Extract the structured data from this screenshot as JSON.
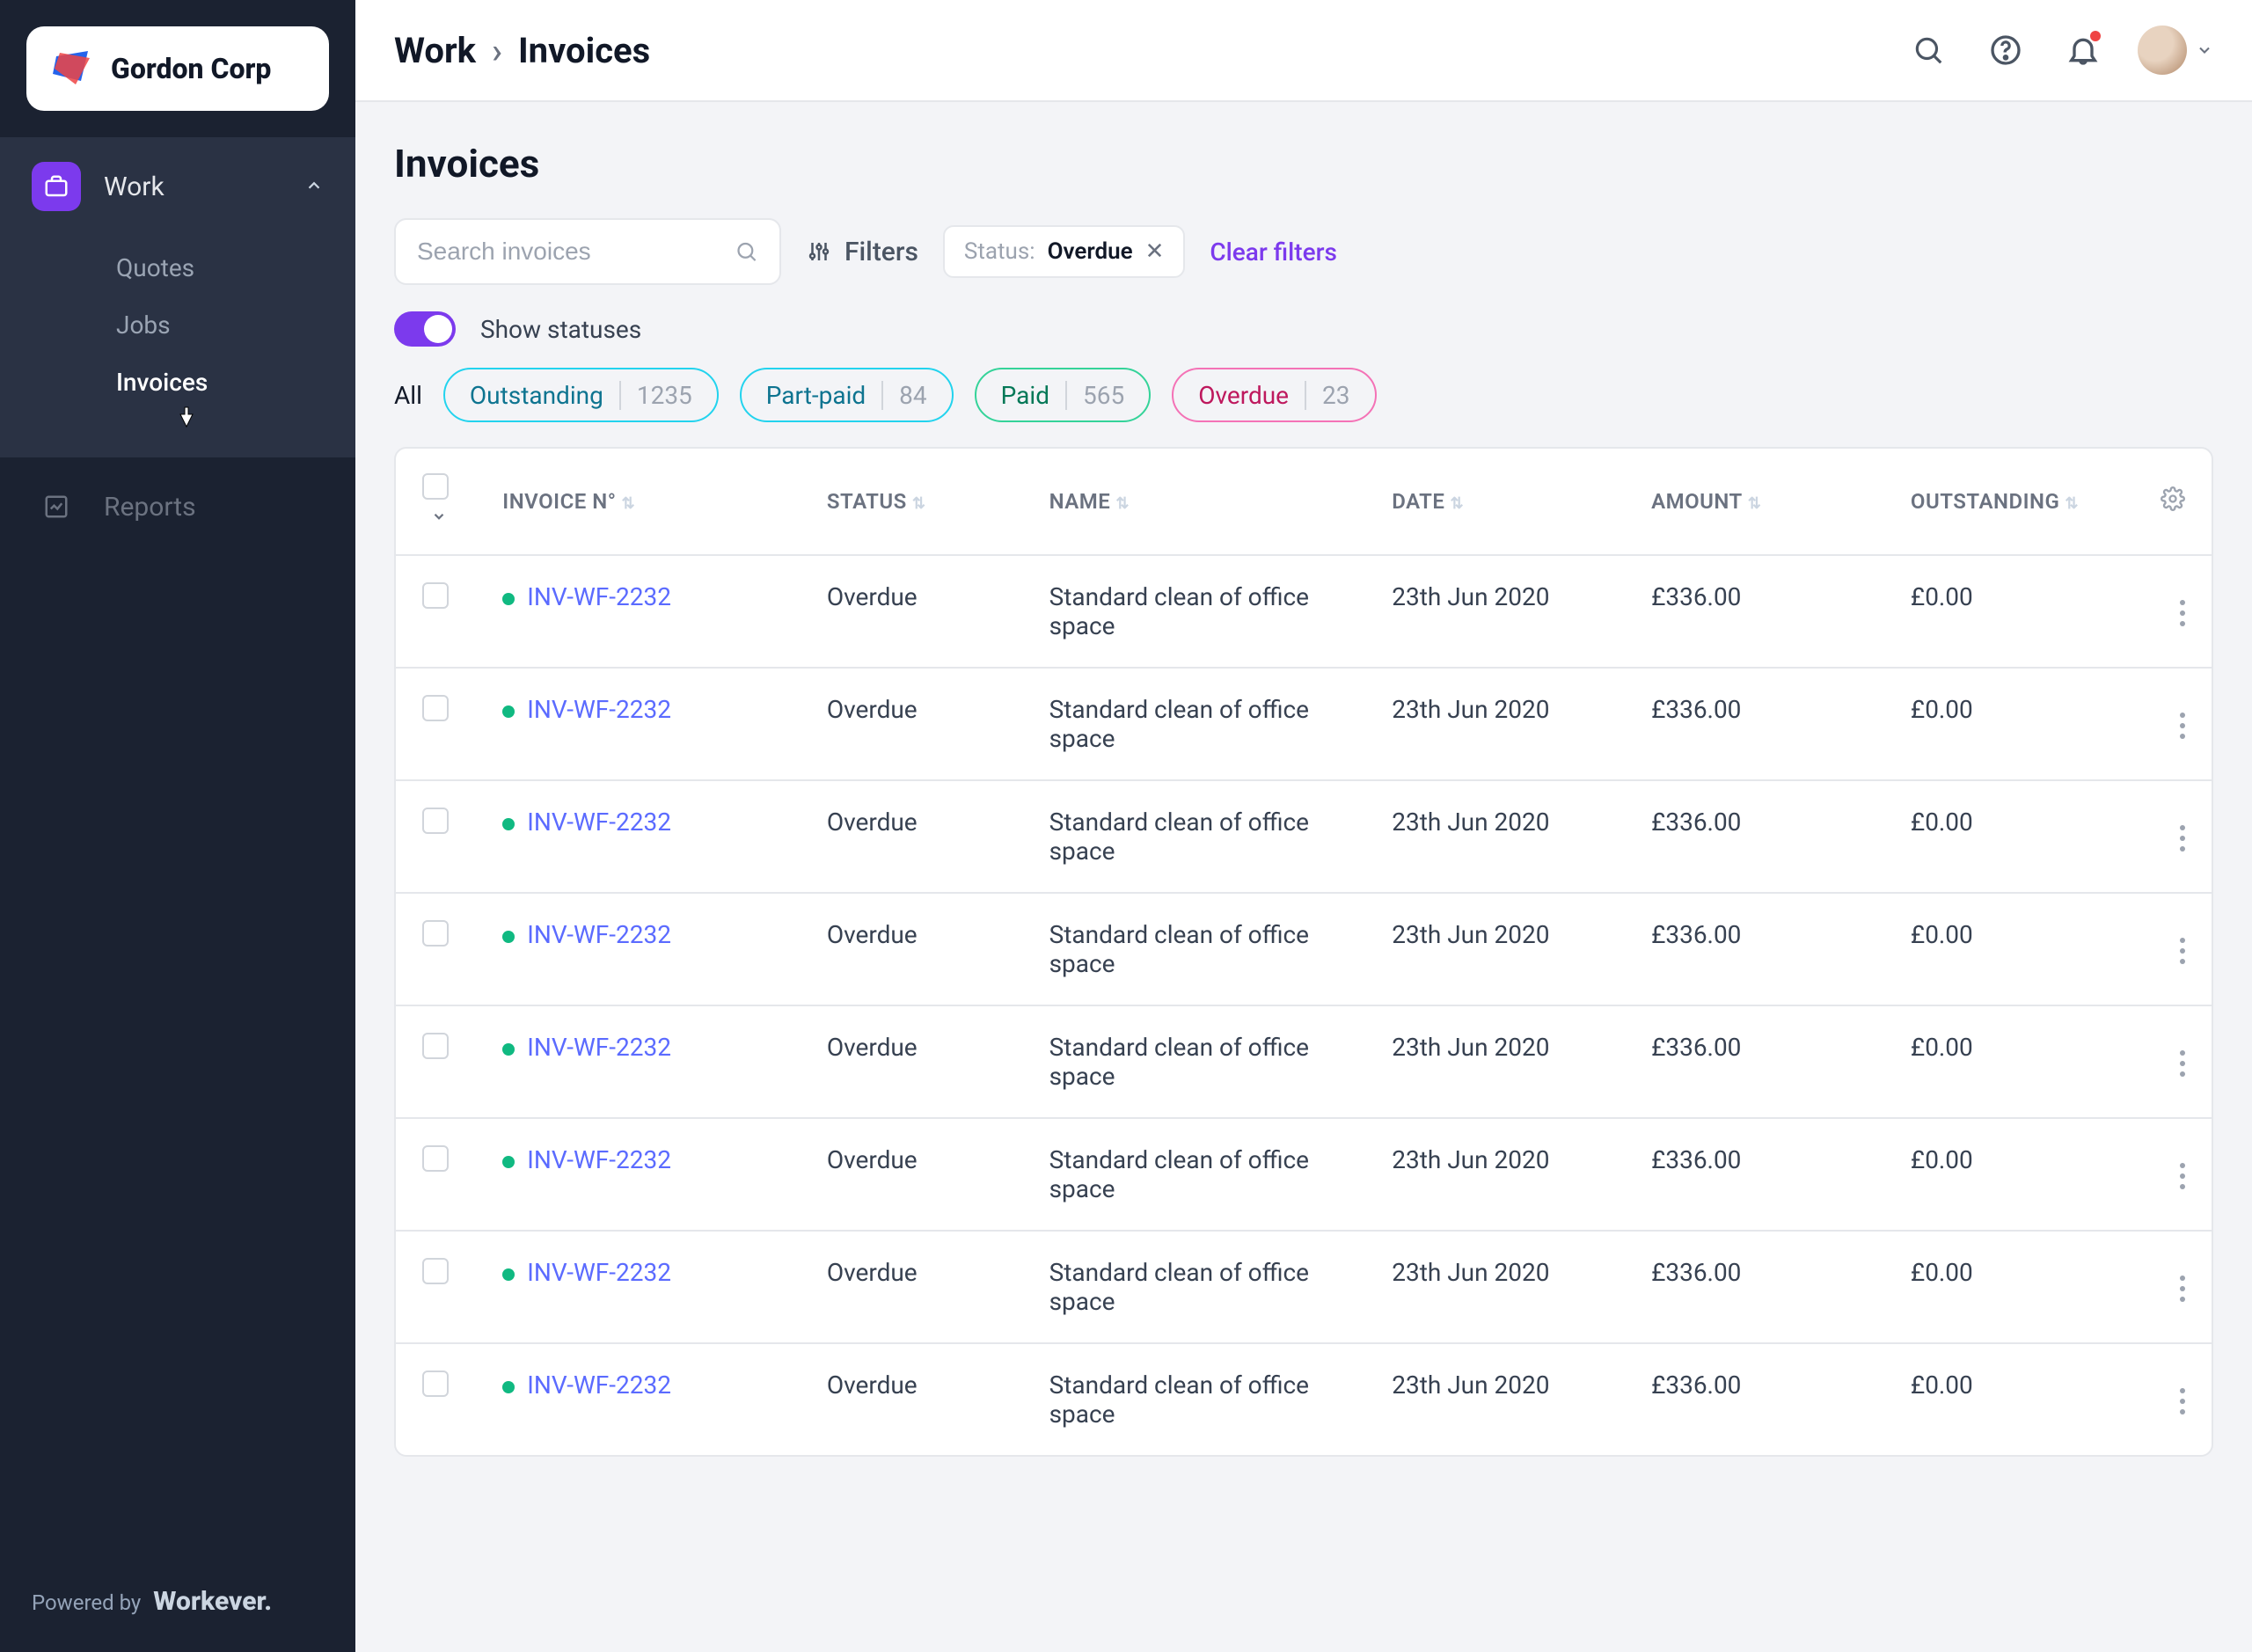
{
  "brand": "Gordon Corp",
  "sidebar": {
    "work": {
      "label": "Work",
      "sub": {
        "quotes": "Quotes",
        "jobs": "Jobs",
        "invoices": "Invoices"
      }
    },
    "reports": {
      "label": "Reports"
    },
    "powered_by_prefix": "Powered by",
    "powered_by_brand": "Workever."
  },
  "breadcrumb": {
    "root": "Work",
    "leaf": "Invoices"
  },
  "page": {
    "title": "Invoices"
  },
  "search": {
    "placeholder": "Search invoices"
  },
  "toolbar": {
    "filters_label": "Filters",
    "chip": {
      "label": "Status:",
      "value": "Overdue"
    },
    "clear": "Clear filters",
    "show_statuses": "Show statuses",
    "all": "All",
    "pills": {
      "outstanding": {
        "label": "Outstanding",
        "count": "1235"
      },
      "partpaid": {
        "label": "Part-paid",
        "count": "84"
      },
      "paid": {
        "label": "Paid",
        "count": "565"
      },
      "overdue": {
        "label": "Overdue",
        "count": "23"
      }
    }
  },
  "columns": {
    "invoice": "INVOICE N°",
    "status": "STATUS",
    "name": "NAME",
    "date": "DATE",
    "amount": "AMOUNT",
    "outstanding": "OUTSTANDING"
  },
  "rows": [
    {
      "invoice": "INV-WF-2232",
      "status": "Overdue",
      "name": "Standard clean of office space",
      "date": "23th Jun 2020",
      "amount": "£336.00",
      "outstanding": "£0.00"
    },
    {
      "invoice": "INV-WF-2232",
      "status": "Overdue",
      "name": "Standard clean of office space",
      "date": "23th Jun 2020",
      "amount": "£336.00",
      "outstanding": "£0.00"
    },
    {
      "invoice": "INV-WF-2232",
      "status": "Overdue",
      "name": "Standard clean of office space",
      "date": "23th Jun 2020",
      "amount": "£336.00",
      "outstanding": "£0.00"
    },
    {
      "invoice": "INV-WF-2232",
      "status": "Overdue",
      "name": "Standard clean of office space",
      "date": "23th Jun 2020",
      "amount": "£336.00",
      "outstanding": "£0.00"
    },
    {
      "invoice": "INV-WF-2232",
      "status": "Overdue",
      "name": "Standard clean of office space",
      "date": "23th Jun 2020",
      "amount": "£336.00",
      "outstanding": "£0.00"
    },
    {
      "invoice": "INV-WF-2232",
      "status": "Overdue",
      "name": "Standard clean of office space",
      "date": "23th Jun 2020",
      "amount": "£336.00",
      "outstanding": "£0.00"
    },
    {
      "invoice": "INV-WF-2232",
      "status": "Overdue",
      "name": "Standard clean of office space",
      "date": "23th Jun 2020",
      "amount": "£336.00",
      "outstanding": "£0.00"
    },
    {
      "invoice": "INV-WF-2232",
      "status": "Overdue",
      "name": "Standard clean of office space",
      "date": "23th Jun 2020",
      "amount": "£336.00",
      "outstanding": "£0.00"
    }
  ]
}
